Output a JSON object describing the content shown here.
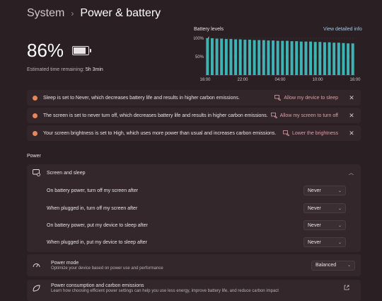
{
  "breadcrumb": {
    "root": "System",
    "separator": "›",
    "current": "Power & battery"
  },
  "battery": {
    "percent": "86%",
    "level": 0.86,
    "remaining_label": "Estimated time remaining:",
    "remaining_value": "5h 3min"
  },
  "chart": {
    "title": "Battery levels",
    "link": "View detailed info",
    "ticks_y": [
      "100%",
      "50%"
    ],
    "ticks_x": [
      "16:00",
      "22:00",
      "04:00",
      "10:00",
      "16:00"
    ],
    "bar_color": "#3fb2b4",
    "chart_data": {
      "type": "bar",
      "ylim": [
        0,
        100
      ],
      "values": [
        100,
        100,
        99,
        99,
        98,
        98,
        97,
        97,
        96,
        96,
        95,
        95,
        95,
        94,
        94,
        93,
        93,
        93,
        92,
        92,
        91,
        91,
        91,
        90,
        90,
        89,
        89,
        88,
        88,
        87,
        86,
        86
      ]
    }
  },
  "notices": [
    {
      "text": "Sleep is set to Never, which decreases battery life and results in higher carbon emissions.",
      "action": "Allow my device to sleep"
    },
    {
      "text": "The screen is set to never turn off, which decreases battery life and results in higher carbon emissions.",
      "action": "Allow my screen to turn off"
    },
    {
      "text": "Your screen brightness is set to High, which uses more power than usual and increases carbon emissions.",
      "action": "Lower the brightness"
    }
  ],
  "power": {
    "section_label": "Power",
    "screen_sleep": {
      "title": "Screen and sleep",
      "rows": [
        {
          "label": "On battery power, turn off my screen after",
          "value": "Never"
        },
        {
          "label": "When plugged in, turn off my screen after",
          "value": "Never"
        },
        {
          "label": "On battery power, put my device to sleep after",
          "value": "Never"
        },
        {
          "label": "When plugged in, put my device to sleep after",
          "value": "Never"
        }
      ]
    },
    "power_mode": {
      "title": "Power mode",
      "subtitle": "Optimize your device based on power use and performance",
      "value": "Balanced"
    },
    "carbon": {
      "title": "Power consumption and carbon emissions",
      "subtitle": "Learn how choosing efficient power settings can help you use less energy, improve battery life, and reduce carbon impact"
    }
  }
}
